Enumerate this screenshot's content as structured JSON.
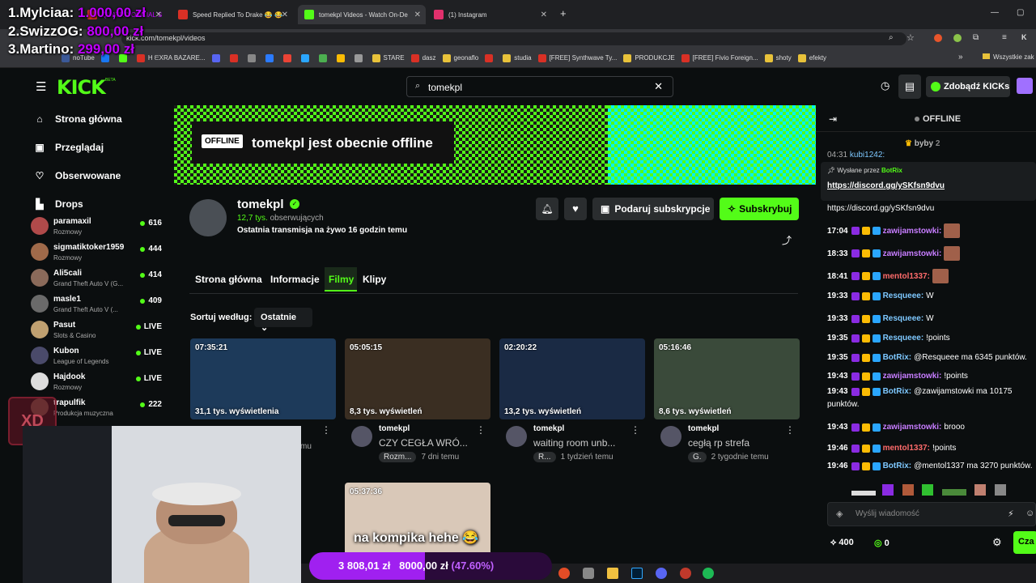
{
  "browser": {
    "tabs": [
      {
        "label": "QUATRO OFICIAL S",
        "color": "#d93025"
      },
      {
        "label": "Speed Replied To Drake 😂 😂",
        "color": "#d93025"
      },
      {
        "label": "tomekpl Videos - Watch On-De",
        "color": "#53fc18"
      },
      {
        "label": "(1) Instagram",
        "color": "#e1306c"
      }
    ],
    "new_tab": "+",
    "url": "kick.com/tomekpl/videos",
    "bookmarks": [
      {
        "label": "noTube",
        "color": "#3b5998"
      },
      {
        "label": "",
        "color": "#1877f2"
      },
      {
        "label": "",
        "color": "#53fc18"
      },
      {
        "label": "H ᗴXRA BAZARE...",
        "color": "#d93025"
      },
      {
        "label": "",
        "color": "#5865f2"
      },
      {
        "label": "",
        "color": "#d93025"
      },
      {
        "label": "",
        "color": "#888888"
      },
      {
        "label": "",
        "color": "#2b7bff"
      },
      {
        "label": "",
        "color": "#ea4335"
      },
      {
        "label": "",
        "color": "#2aa6ff"
      },
      {
        "label": "",
        "color": "#4caf50"
      },
      {
        "label": "",
        "color": "#fbbc04"
      },
      {
        "label": "",
        "color": "#999999"
      },
      {
        "label": "STARE",
        "color": "#e8c23a"
      },
      {
        "label": "dasz",
        "color": "#d93025"
      },
      {
        "label": "geonaflo",
        "color": "#e8c23a"
      },
      {
        "label": "",
        "color": "#d93025"
      },
      {
        "label": "studia",
        "color": "#e8c23a"
      },
      {
        "label": "[FREE] Synthwave Ty...",
        "color": "#d93025"
      },
      {
        "label": "PRODUKCJE",
        "color": "#e8c23a"
      },
      {
        "label": "[FREE] Fivio Foreign...",
        "color": "#d93025"
      },
      {
        "label": "shoty",
        "color": "#e8c23a"
      },
      {
        "label": "efekty",
        "color": "#e8c23a"
      }
    ],
    "more_bookmarks": "»",
    "all_bookmarks": "Wszystkie zak"
  },
  "overlay": {
    "donors": [
      {
        "rank": "1.",
        "name": "Mylciaa:",
        "amount": "1.000,00 zł"
      },
      {
        "rank": "2.",
        "name": "SwizzOG:",
        "amount": "800,00 zł"
      },
      {
        "rank": "3.",
        "name": "Martino:",
        "amount": "299,00 zł"
      }
    ],
    "goal": {
      "current": "3 808,01 zł",
      "target": "8000,00 zł",
      "percent": "(47.60%)",
      "fraction": 0.476
    },
    "caption": "na kompika hehe 😂",
    "xd": "XD"
  },
  "kick": {
    "logo": "KICK",
    "beta": "BETA",
    "search": {
      "value": "tomekpl"
    },
    "get_kicks": "Zdobądź KICKs"
  },
  "sidebar": {
    "nav": [
      {
        "label": "Strona główna",
        "icon": "home-icon"
      },
      {
        "label": "Przeglądaj",
        "icon": "browse-icon"
      },
      {
        "label": "Obserwowane",
        "icon": "heart-icon"
      },
      {
        "label": "Drops",
        "icon": "drops-icon"
      }
    ],
    "channels": [
      {
        "name": "paramaxil",
        "category": "Rozmowy",
        "viewers": "616",
        "live": false,
        "color": "#b04a4a"
      },
      {
        "name": "sigmatiktoker1959",
        "category": "Rozmowy",
        "viewers": "444",
        "live": false,
        "color": "#a06a4a"
      },
      {
        "name": "Ali5cali",
        "category": "Grand Theft Auto V (G...",
        "viewers": "414",
        "live": false,
        "color": "#8a6a5a"
      },
      {
        "name": "masle1",
        "category": "Grand Theft Auto V (...",
        "viewers": "409",
        "live": false,
        "color": "#6a6a6a"
      },
      {
        "name": "Pasut",
        "category": "Slots & Casino",
        "viewers": "LIVE",
        "live": true,
        "color": "#c0a070"
      },
      {
        "name": "Kubon",
        "category": "League of Legends",
        "viewers": "LIVE",
        "live": true,
        "color": "#4a4a6a"
      },
      {
        "name": "Hajdook",
        "category": "Rozmowy",
        "viewers": "LIVE",
        "live": true,
        "color": "#dddddd"
      },
      {
        "name": "trapulfik",
        "category": "Produkcja muzyczna",
        "viewers": "222",
        "live": false,
        "color": "#5a4a3a"
      }
    ]
  },
  "channel": {
    "offline_badge": "OFFLINE",
    "offline_text": "tomekpl jest obecnie offline",
    "name": "tomekpl",
    "followers_count": "12,7 tys.",
    "followers_label": "obserwujących",
    "last_stream": "Ostatnia transmisja na żywo 16 godzin temu",
    "gift_sub": "Podaruj subskrypcje",
    "subscribe": "Subskrybuj",
    "tabs": [
      "Strona główna",
      "Informacje",
      "Filmy",
      "Klipy"
    ],
    "active_tab": "Filmy",
    "sort_label": "Sortuj według:",
    "sort_value": "Ostatnie"
  },
  "videos": [
    {
      "duration": "07:35:21",
      "views": "31,1 tys. wyświetlenia",
      "channel": "",
      "title": "",
      "category": "",
      "age": "mu",
      "bg": "#1d3a5a"
    },
    {
      "duration": "05:05:15",
      "views": "8,3 tys. wyświetleń",
      "channel": "tomekpl",
      "title": "CZY CEGŁA WRÓ...",
      "category": "Rozm...",
      "age": "7 dni temu",
      "bg": "#3a2e22"
    },
    {
      "duration": "02:20:22",
      "views": "13,2 tys. wyświetleń",
      "channel": "tomekpl",
      "title": "waiting room unb...",
      "category": "R...",
      "age": "1 tydzień temu",
      "bg": "#1a2a44"
    },
    {
      "duration": "05:16:46",
      "views": "8,6 tys. wyświetleń",
      "channel": "tomekpl",
      "title": "cegłą rp strefa",
      "category": "G.",
      "age": "2 tygodnie temu",
      "bg": "#3a4a3a"
    },
    {
      "duration": "05:37:36",
      "views": "",
      "channel": "",
      "title": "",
      "category": "",
      "age": "",
      "bg": "#d9c8b8"
    }
  ],
  "chat": {
    "status": "OFFLINE",
    "pinned_user": "byby",
    "pinned_count": "2",
    "pinned_by_label": "Wysłane przez",
    "pinned_by_user": "BotRix",
    "pinned_link": "https://discord.gg/ySKfsn9dvu",
    "pinned_time": "04:31",
    "pinned_prev_user": "kubi1242:",
    "messages": [
      {
        "time": "",
        "user": "",
        "text": "https://discord.gg/ySKfsn9dvu",
        "color": "#ffffff"
      },
      {
        "time": "17:04",
        "user": "zawijamstowki:",
        "text": "",
        "color": "#c77dff"
      },
      {
        "time": "18:33",
        "user": "zawijamstowki:",
        "text": "",
        "color": "#c77dff"
      },
      {
        "time": "18:41",
        "user": "mentol1337:",
        "text": "",
        "color": "#ff6b6b"
      },
      {
        "time": "19:33",
        "user": "Resqueee:",
        "text": "W",
        "color": "#7ec8ff"
      },
      {
        "time": "19:33",
        "user": "Resqueee:",
        "text": "W",
        "color": "#7ec8ff"
      },
      {
        "time": "19:35",
        "user": "Resqueee:",
        "text": "!points",
        "color": "#7ec8ff"
      },
      {
        "time": "19:35",
        "user": "BotRix:",
        "text": "@Resqueee ma 6345 punktów.",
        "color": "#7ec8ff"
      },
      {
        "time": "19:43",
        "user": "zawijamstowki:",
        "text": "!points",
        "color": "#c77dff"
      },
      {
        "time": "19:43",
        "user": "BotRix:",
        "text": "@zawijamstowki ma 10175",
        "color": "#7ec8ff"
      },
      {
        "time": "",
        "user": "",
        "text": "punktów.",
        "color": "#ffffff"
      },
      {
        "time": "19:43",
        "user": "zawijamstowki:",
        "text": "brooo",
        "color": "#c77dff"
      },
      {
        "time": "19:46",
        "user": "mentol1337:",
        "text": "!points",
        "color": "#ff6b6b"
      },
      {
        "time": "19:46",
        "user": "BotRix:",
        "text": "@mentol1337 ma 3270 punktów.",
        "color": "#7ec8ff"
      }
    ],
    "input_placeholder": "Wyślij wiadomość",
    "points": "400",
    "kicks": "0",
    "send": "Cza"
  }
}
